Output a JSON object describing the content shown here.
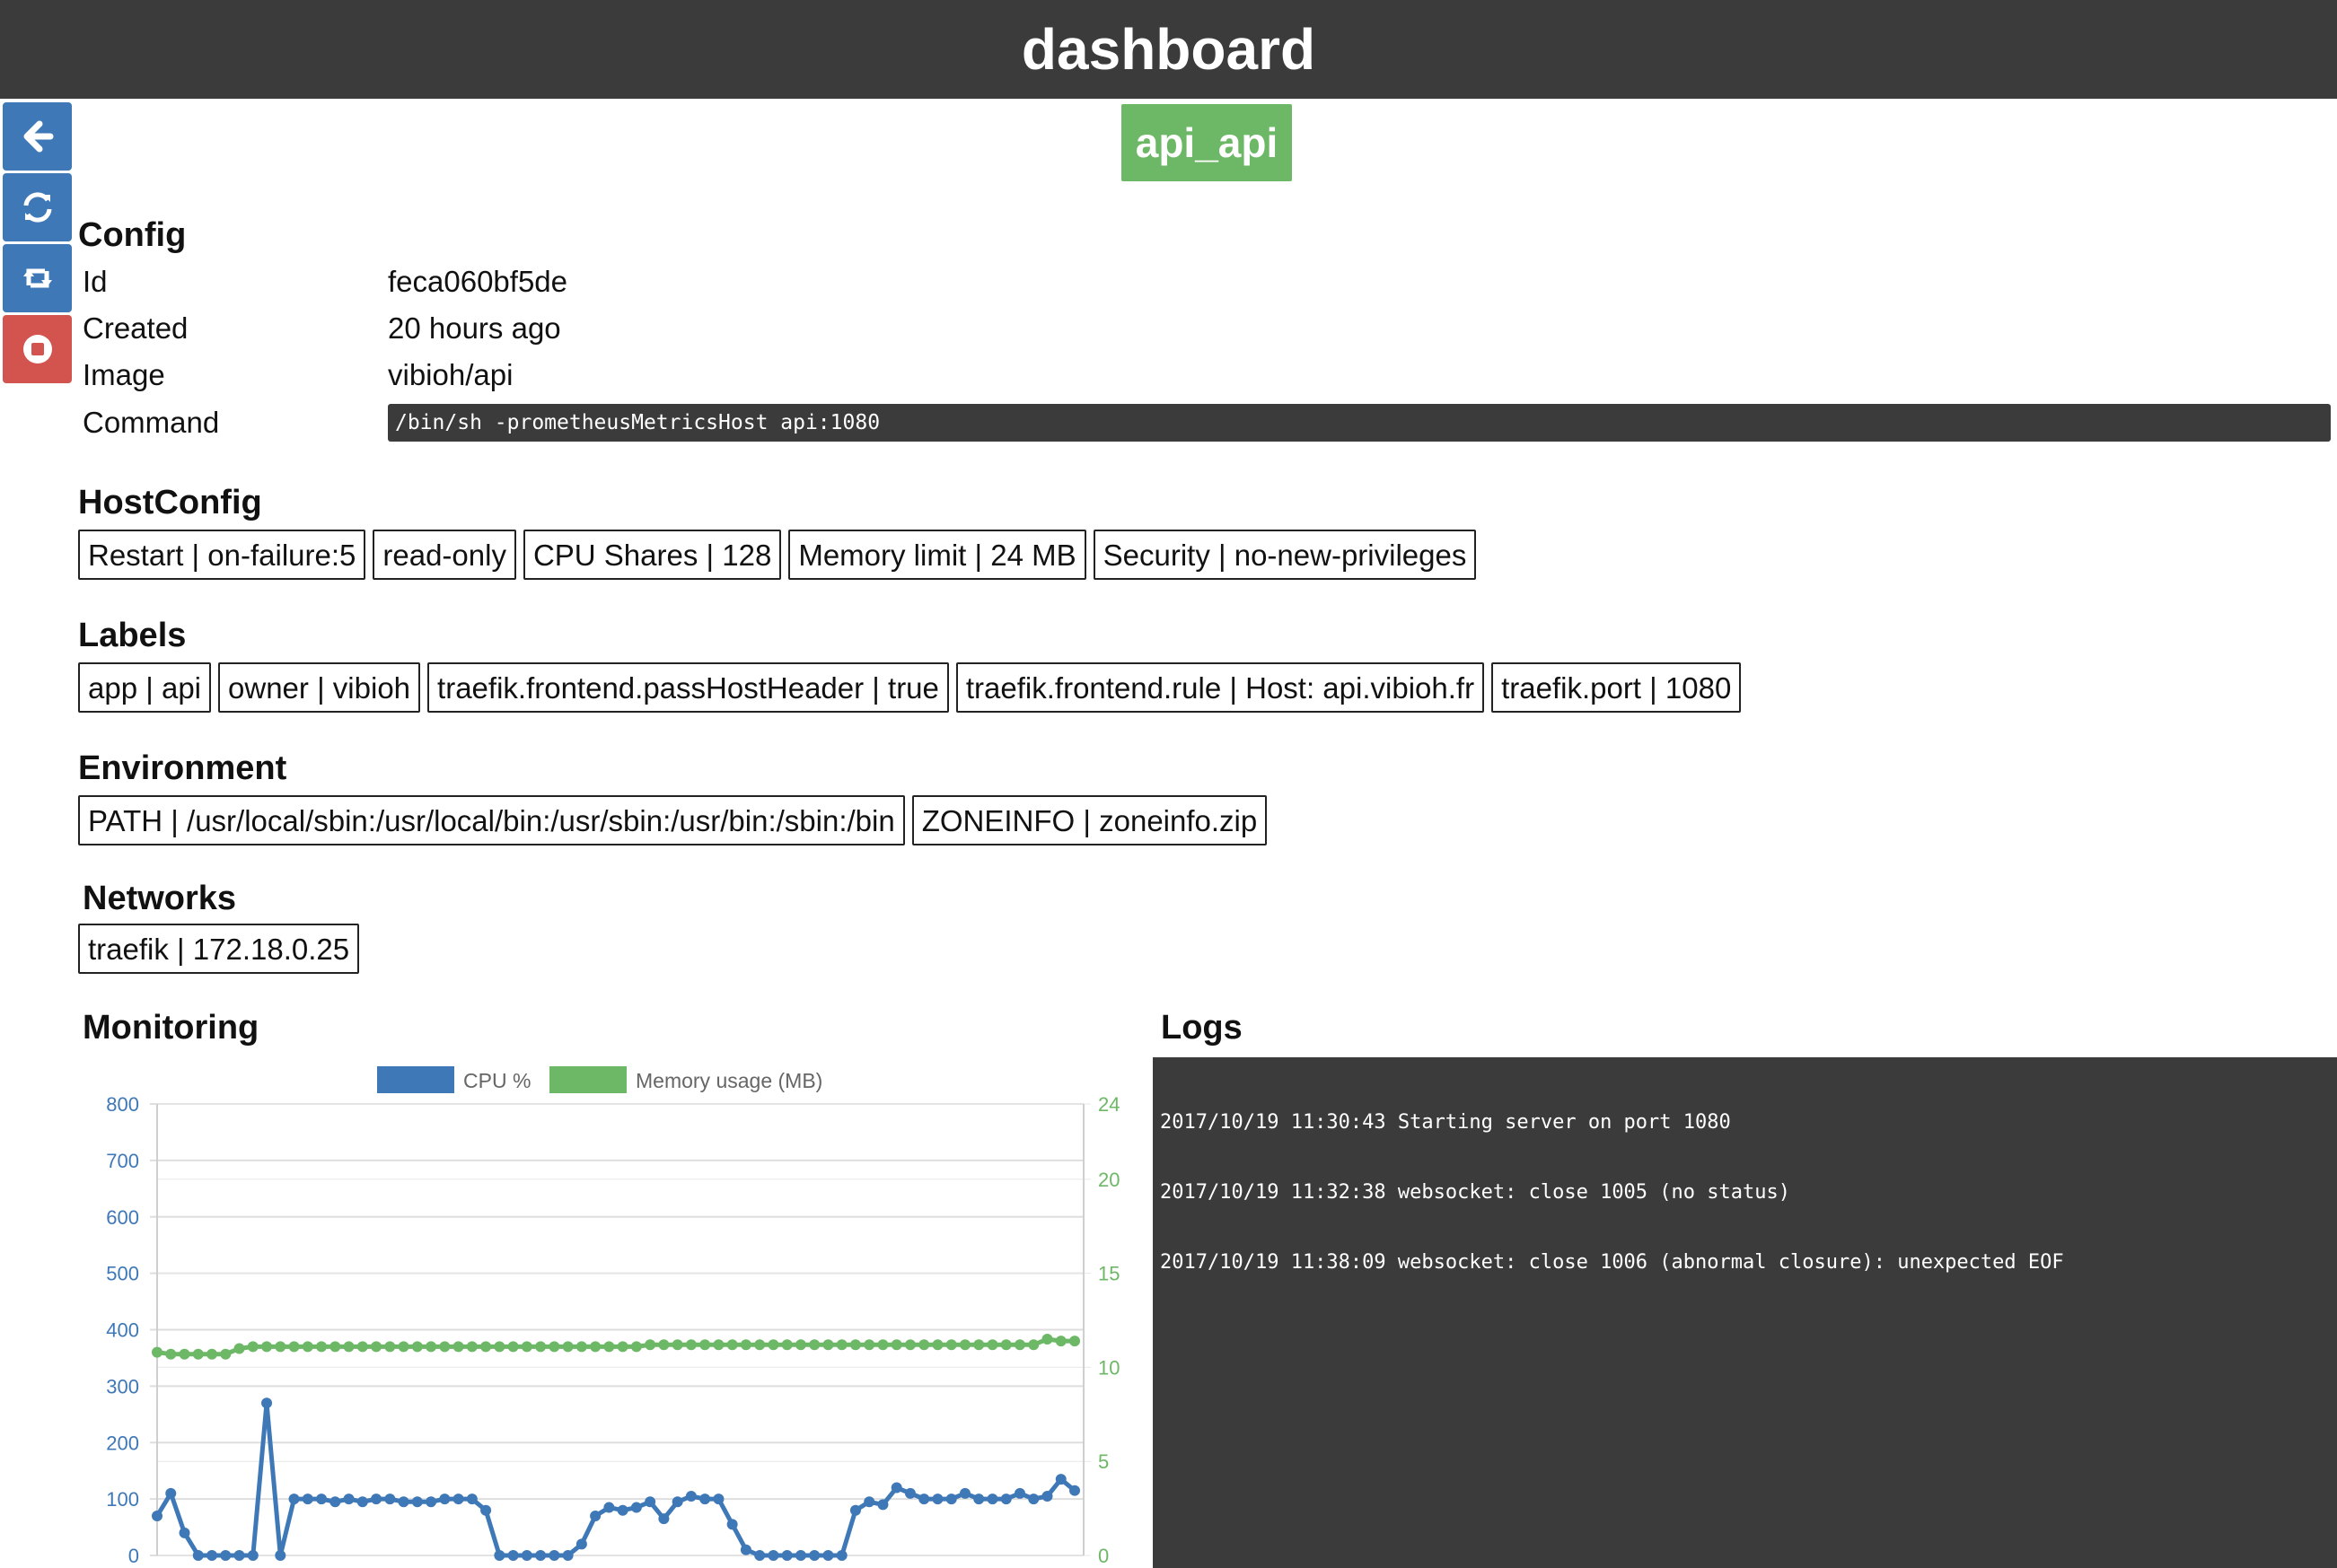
{
  "header": {
    "title": "dashboard"
  },
  "sidebar": {
    "buttons": [
      {
        "icon": "arrow-left-icon",
        "color": "#3e78b7"
      },
      {
        "icon": "refresh-icon",
        "color": "#3e78b7"
      },
      {
        "icon": "restart-icon",
        "color": "#3e78b7"
      },
      {
        "icon": "stop-icon",
        "color": "#d3534e"
      }
    ]
  },
  "container": {
    "name": "api_api",
    "status_color": "#6db866"
  },
  "config": {
    "title": "Config",
    "rows": [
      {
        "key": "Id",
        "value": "feca060bf5de"
      },
      {
        "key": "Created",
        "value": "20 hours ago"
      },
      {
        "key": "Image",
        "value": "vibioh/api"
      }
    ],
    "command_key": "Command",
    "command_value": "/bin/sh -prometheusMetricsHost api:1080"
  },
  "hostconfig": {
    "title": "HostConfig",
    "chips": [
      "Restart | on-failure:5",
      "read-only",
      "CPU Shares | 128",
      "Memory limit | 24 MB",
      "Security | no-new-privileges"
    ]
  },
  "labels": {
    "title": "Labels",
    "chips": [
      "app | api",
      "owner | vibioh",
      "traefik.frontend.passHostHeader | true",
      "traefik.frontend.rule | Host: api.vibioh.fr",
      "traefik.port | 1080"
    ]
  },
  "environment": {
    "title": "Environment",
    "chips": [
      "PATH | /usr/local/sbin:/usr/local/bin:/usr/sbin:/usr/bin:/sbin:/bin",
      "ZONEINFO | zoneinfo.zip"
    ]
  },
  "networks": {
    "title": "Networks",
    "chips": [
      "traefik | 172.18.0.25"
    ]
  },
  "monitoring": {
    "title": "Monitoring"
  },
  "logs": {
    "title": "Logs",
    "lines": [
      "2017/10/19 11:30:43 Starting server on port 1080",
      "2017/10/19 11:32:38 websocket: close 1005 (no status)",
      "2017/10/19 11:38:09 websocket: close 1006 (abnormal closure): unexpected EOF"
    ]
  },
  "chart_data": {
    "type": "line",
    "series": [
      {
        "name": "CPU %",
        "color": "#3e78b7",
        "axis": "left",
        "values": [
          70,
          110,
          40,
          0,
          0,
          0,
          0,
          0,
          270,
          0,
          100,
          100,
          100,
          95,
          100,
          95,
          100,
          100,
          95,
          95,
          95,
          100,
          100,
          100,
          80,
          0,
          0,
          0,
          0,
          0,
          0,
          20,
          70,
          85,
          80,
          85,
          95,
          65,
          95,
          105,
          100,
          100,
          55,
          10,
          0,
          0,
          0,
          0,
          0,
          0,
          0,
          80,
          95,
          90,
          120,
          110,
          100,
          100,
          100,
          110,
          100,
          100,
          100,
          110,
          100,
          105,
          135,
          115
        ]
      },
      {
        "name": "Memory usage (MB)",
        "color": "#6db866",
        "axis": "right",
        "values": [
          10.8,
          10.7,
          10.7,
          10.7,
          10.7,
          10.7,
          11.0,
          11.1,
          11.1,
          11.1,
          11.1,
          11.1,
          11.1,
          11.1,
          11.1,
          11.1,
          11.1,
          11.1,
          11.1,
          11.1,
          11.1,
          11.1,
          11.1,
          11.1,
          11.1,
          11.1,
          11.1,
          11.1,
          11.1,
          11.1,
          11.1,
          11.1,
          11.1,
          11.1,
          11.1,
          11.1,
          11.2,
          11.2,
          11.2,
          11.2,
          11.2,
          11.2,
          11.2,
          11.2,
          11.2,
          11.2,
          11.2,
          11.2,
          11.2,
          11.2,
          11.2,
          11.2,
          11.2,
          11.2,
          11.2,
          11.2,
          11.2,
          11.2,
          11.2,
          11.2,
          11.2,
          11.2,
          11.2,
          11.2,
          11.2,
          11.5,
          11.4,
          11.4
        ]
      }
    ],
    "y_left": {
      "min": 0,
      "max": 800,
      "ticks": [
        0,
        100,
        200,
        300,
        400,
        500,
        600,
        700,
        800
      ],
      "color": "#3e78b7"
    },
    "y_right": {
      "min": 0,
      "max": 24,
      "ticks": [
        0,
        5,
        10,
        15,
        20,
        24
      ],
      "color": "#6db866"
    },
    "grid": true,
    "legend": "top"
  }
}
